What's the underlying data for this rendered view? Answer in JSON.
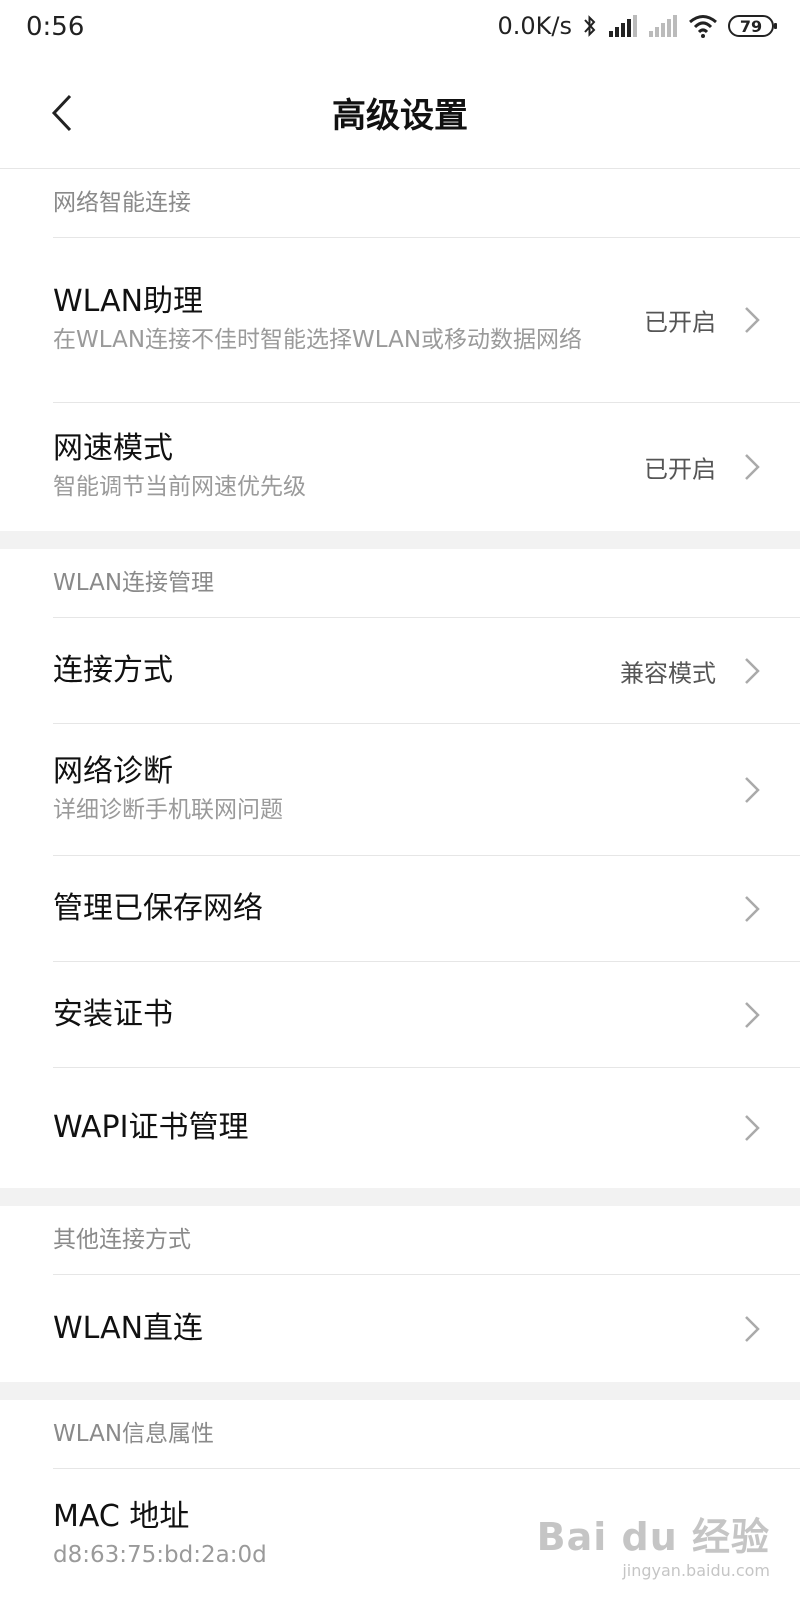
{
  "status": {
    "time": "0:56",
    "speed": "0.0K/s",
    "battery": "79"
  },
  "header": {
    "title": "高级设置"
  },
  "sections": [
    {
      "title": "网络智能连接",
      "rows": [
        {
          "title": "WLAN助理",
          "sub": "在WLAN连接不佳时智能选择WLAN或移动数据网络",
          "value": "已开启"
        },
        {
          "title": "网速模式",
          "sub": "智能调节当前网速优先级",
          "value": "已开启"
        }
      ]
    },
    {
      "title": "WLAN连接管理",
      "rows": [
        {
          "title": "连接方式",
          "value": "兼容模式"
        },
        {
          "title": "网络诊断",
          "sub": "详细诊断手机联网问题"
        },
        {
          "title": "管理已保存网络"
        },
        {
          "title": "安装证书"
        },
        {
          "title": "WAPI证书管理"
        }
      ]
    },
    {
      "title": "其他连接方式",
      "rows": [
        {
          "title": "WLAN直连"
        }
      ]
    },
    {
      "title": "WLAN信息属性",
      "rows": [
        {
          "title": "MAC 地址",
          "sub": "d8:63:75:bd:2a:0d"
        }
      ]
    }
  ],
  "watermark": {
    "logo": "Bai du 经验",
    "url": "jingyan.baidu.com"
  }
}
